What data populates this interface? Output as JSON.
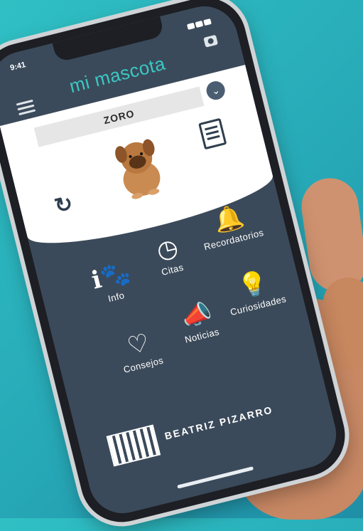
{
  "status": {
    "time": "9:41"
  },
  "app": {
    "title": "mi mascota"
  },
  "profile": {
    "pet_name": "ZORO"
  },
  "menu": [
    {
      "label": "Info",
      "icon": "info-paw-icon"
    },
    {
      "label": "Citas",
      "icon": "clock-icon"
    },
    {
      "label": "Recordatorios",
      "icon": "bell-icon"
    },
    {
      "label": "Consejos",
      "icon": "heart-icon"
    },
    {
      "label": "Noticias",
      "icon": "megaphone-icon"
    },
    {
      "label": "Curiosidades",
      "icon": "lightbulb-icon"
    }
  ],
  "footer": {
    "author": "BEATRIZ PIZARRO"
  },
  "colors": {
    "accent": "#39c9c4",
    "panel": "#3b4a5a",
    "background": "#2fc0c4"
  }
}
